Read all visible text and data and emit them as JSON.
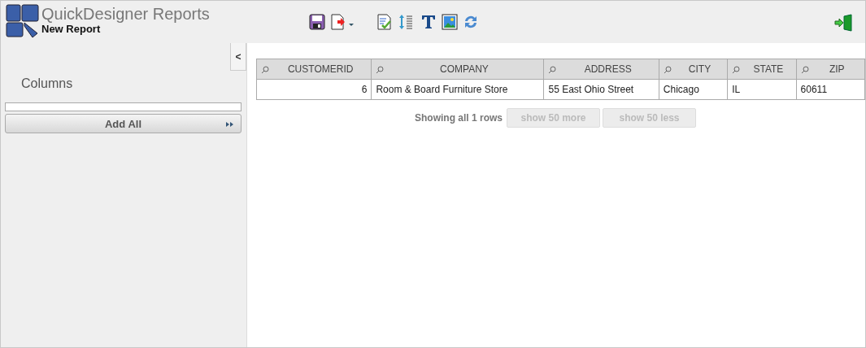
{
  "header": {
    "title": "QuickDesigner Reports",
    "subtitle": "New Report"
  },
  "toolbar": [
    {
      "kind": "save"
    },
    {
      "kind": "export"
    },
    {
      "kind": "edit"
    },
    {
      "kind": "spacing"
    },
    {
      "kind": "text"
    },
    {
      "kind": "image"
    },
    {
      "kind": "refresh"
    }
  ],
  "sidebar": {
    "collapse": "<",
    "heading": "Columns",
    "add_all": "Add All"
  },
  "table": {
    "columns": [
      {
        "label": "CUSTOMERID"
      },
      {
        "label": "COMPANY"
      },
      {
        "label": "ADDRESS"
      },
      {
        "label": "CITY"
      },
      {
        "label": "STATE"
      },
      {
        "label": "ZIP"
      }
    ],
    "rows": [
      [
        "6",
        "Room & Board Furniture Store",
        "55 East Ohio Street",
        "Chicago",
        "IL",
        "60611"
      ]
    ]
  },
  "pager": {
    "status": "Showing all 1 rows",
    "buttons": [
      {
        "label": "show 50 more",
        "disabled": true
      },
      {
        "label": "show 50 less",
        "disabled": true
      }
    ]
  }
}
